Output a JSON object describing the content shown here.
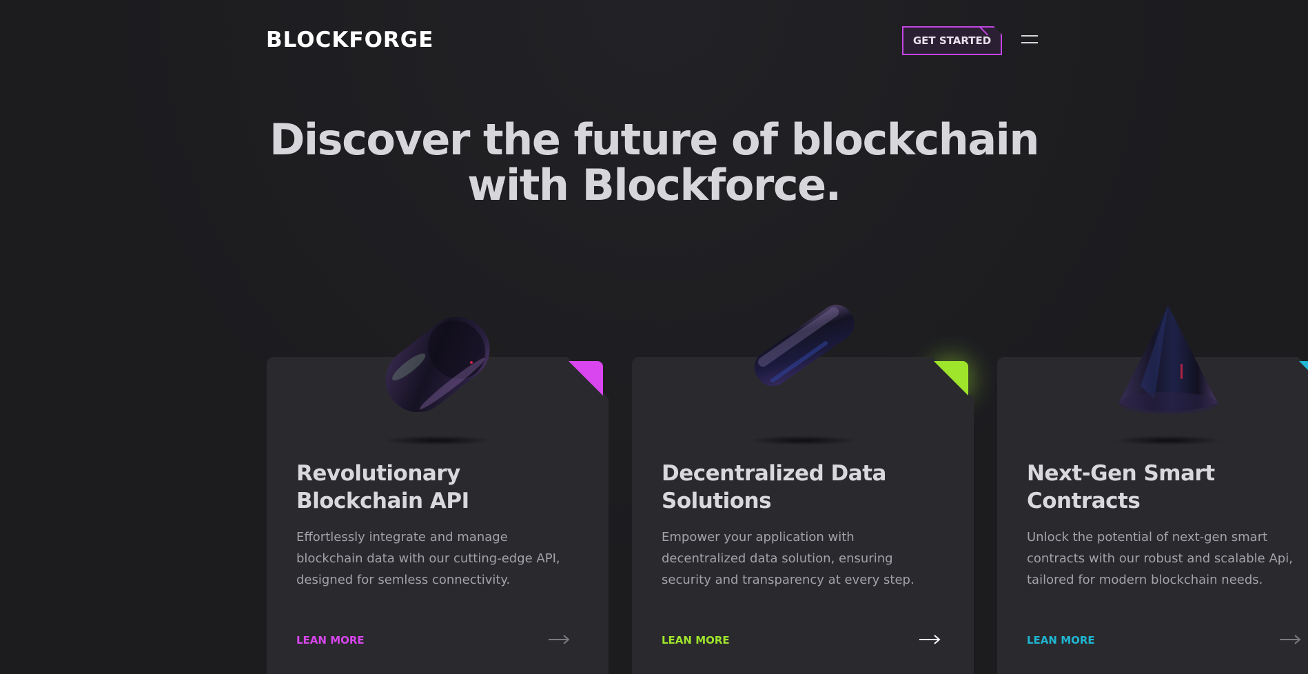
{
  "header": {
    "logo": "BLOCKFORGE",
    "cta_label": "GET STARTED",
    "menu_icon": "hamburger-menu-icon"
  },
  "hero": {
    "line1": "Discover the future of blockchain",
    "line2": "with Blockforce."
  },
  "cards": [
    {
      "title_line1": "Revolutionary",
      "title_line2": "Blockchain API",
      "desc_line1": "Effortlessly integrate and manage",
      "desc_line2": "blockchain data with our cutting-edge API,",
      "desc_line3": "designed for semless connectivity.",
      "link": "LEAN MORE",
      "accent": "#d946ef",
      "object_icon": "capsule-3d-icon"
    },
    {
      "title_line1": "Decentralized Data",
      "title_line2": "Solutions",
      "desc_line1": "Empower your application with",
      "desc_line2": "decentralized data solution, ensuring",
      "desc_line3": "security and transparency at every step.",
      "link": "LEAN MORE",
      "accent": "#9fe52c",
      "object_icon": "rounded-bar-3d-icon"
    },
    {
      "title_line1": "Next-Gen Smart",
      "title_line2": "Contracts",
      "desc_line1": "Unlock the potential of next-gen smart",
      "desc_line2": "contracts with our robust and scalable Api,",
      "desc_line3": "tailored for modern blockchain needs.",
      "link": "LEAN MORE",
      "accent": "#1fb7d4",
      "object_icon": "cone-3d-icon"
    }
  ]
}
